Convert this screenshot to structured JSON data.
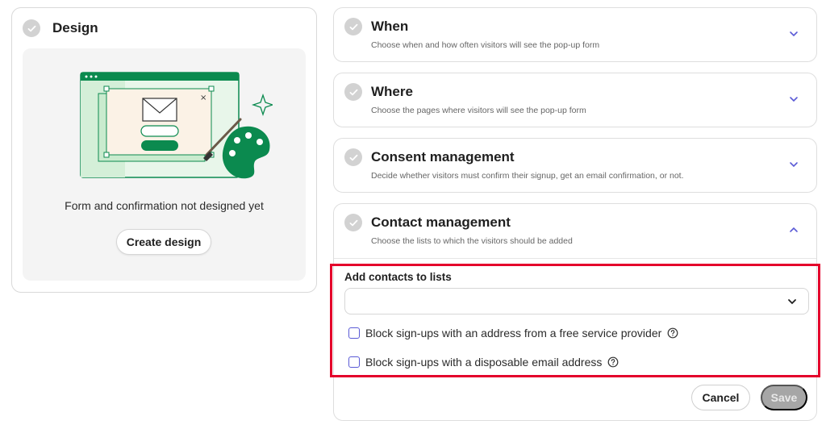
{
  "design": {
    "title": "Design",
    "message": "Form and confirmation not designed yet",
    "create_button": "Create design",
    "illustration_icon": "form-design-illustration"
  },
  "sections": [
    {
      "title": "When",
      "description": "Choose when and how often visitors will see the pop-up form",
      "expanded": false
    },
    {
      "title": "Where",
      "description": "Choose the pages where visitors will see the pop-up form",
      "expanded": false
    },
    {
      "title": "Consent management",
      "description": "Decide whether visitors must confirm their signup, get an email confirmation, or not.",
      "expanded": false
    },
    {
      "title": "Contact management",
      "description": "Choose the lists to which the visitors should be added",
      "expanded": true
    }
  ],
  "contact_management": {
    "field_label": "Add contacts to lists",
    "select_value": "",
    "checkboxes": [
      {
        "label": "Block sign-ups with an address from a free service provider",
        "checked": false
      },
      {
        "label": "Block sign-ups with a disposable email address",
        "checked": false
      }
    ],
    "cancel_button": "Cancel",
    "save_button": "Save"
  },
  "colors": {
    "accent_green": "#0b8a4f",
    "light_green": "#dff3e2",
    "chevron_blue": "#5a5ad6",
    "highlight_red": "#e4002b",
    "disabled_gray": "#a6a6a6"
  }
}
